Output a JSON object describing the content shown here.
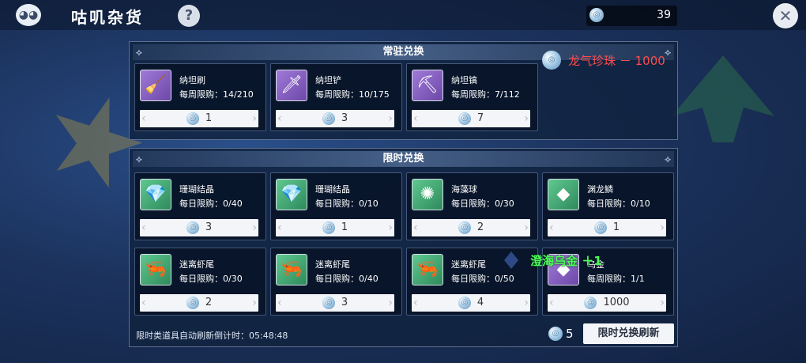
{
  "header": {
    "title": "咕叽杂货",
    "help_icon": "?",
    "currency_amount": "39",
    "close_icon": "✕"
  },
  "permanent": {
    "title": "常驻兑换",
    "items": [
      {
        "name": "纳坦刷",
        "limit": "每周限购：14/210",
        "price": "1",
        "icon": "🧹",
        "bg": "purple"
      },
      {
        "name": "纳坦铲",
        "limit": "每周限购：10/175",
        "price": "3",
        "icon": "🗡",
        "bg": "purple"
      },
      {
        "name": "纳坦镐",
        "limit": "每周限购：7/112",
        "price": "7",
        "icon": "⛏",
        "bg": "purple"
      }
    ]
  },
  "limited": {
    "title": "限时兑换",
    "items": [
      {
        "name": "珊瑚结晶",
        "limit": "每日限购：0/40",
        "price": "3",
        "icon": "💎",
        "bg": "green"
      },
      {
        "name": "珊瑚结晶",
        "limit": "每日限购：0/10",
        "price": "1",
        "icon": "💎",
        "bg": "green"
      },
      {
        "name": "海藻球",
        "limit": "每日限购：0/30",
        "price": "2",
        "icon": "✺",
        "bg": "green"
      },
      {
        "name": "渊龙鳞",
        "limit": "每日限购：0/10",
        "price": "1",
        "icon": "◆",
        "bg": "green"
      },
      {
        "name": "迷离虾尾",
        "limit": "每日限购：0/30",
        "price": "2",
        "icon": "🦐",
        "bg": "green"
      },
      {
        "name": "迷离虾尾",
        "limit": "每日限购：0/40",
        "price": "3",
        "icon": "🦐",
        "bg": "green"
      },
      {
        "name": "迷离虾尾",
        "limit": "每日限购：0/50",
        "price": "4",
        "icon": "🦐",
        "bg": "green"
      },
      {
        "name": "乌金",
        "limit": "每周限购：1/1",
        "price": "1000",
        "icon": "◆",
        "bg": "purple"
      }
    ]
  },
  "footer": {
    "countdown_text": "限时类道具自动刷新倒计时：05:48:48",
    "refresh_cost": "5",
    "refresh_button": "限时兑换刷新"
  },
  "floating": {
    "red_text": "龙气珍珠 － 1000",
    "green_text": "澄海乌金 ＋1"
  },
  "colors": {
    "red_float": "#ff4c4c",
    "green_float": "#4dff5c"
  }
}
